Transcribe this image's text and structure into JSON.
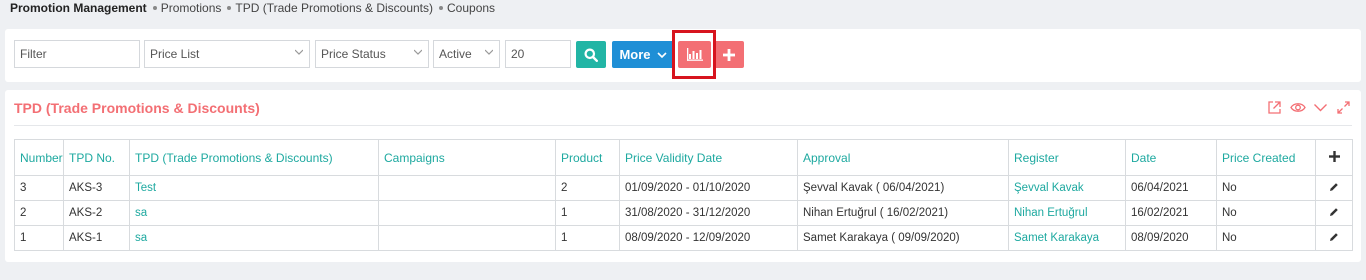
{
  "breadcrumb": {
    "root": "Promotion Management",
    "items": [
      "Promotions",
      "TPD (Trade Promotions & Discounts)",
      "Coupons"
    ]
  },
  "filters": {
    "filter_placeholder": "Filter",
    "price_list": "Price List",
    "price_status": "Price Status",
    "status": "Active",
    "page_size": "20"
  },
  "toolbar": {
    "more_label": "More"
  },
  "panel": {
    "title": "TPD (Trade Promotions & Discounts)"
  },
  "table": {
    "headers": [
      "Number",
      "TPD No.",
      "TPD (Trade Promotions & Discounts)",
      "Campaigns",
      "Product",
      "Price Validity Date",
      "Approval",
      "Register",
      "Date",
      "Price Created"
    ],
    "rows": [
      {
        "number": "3",
        "tpd_no": "AKS-3",
        "name": "Test",
        "campaigns": "",
        "product": "2",
        "validity": "01/09/2020 - 01/10/2020",
        "approval": "Şevval Kavak ( 06/04/2021)",
        "register": "Şevval Kavak",
        "date": "06/04/2021",
        "price_created": "No"
      },
      {
        "number": "2",
        "tpd_no": "AKS-2",
        "name": "sa",
        "campaigns": "",
        "product": "1",
        "validity": "31/08/2020 - 31/12/2020",
        "approval": "Nihan Ertuğrul ( 16/02/2021)",
        "register": "Nihan Ertuğrul",
        "date": "16/02/2021",
        "price_created": "No"
      },
      {
        "number": "1",
        "tpd_no": "AKS-1",
        "name": "sa",
        "campaigns": "",
        "product": "1",
        "validity": "08/09/2020 - 12/09/2020",
        "approval": "Samet Karakaya ( 09/09/2020)",
        "register": "Samet Karakaya",
        "date": "08/09/2020",
        "price_created": "No"
      }
    ]
  },
  "colors": {
    "accent_teal": "#1ea9a0",
    "more_blue": "#1f8fd6",
    "coral": "#f36f74",
    "highlight_red": "#d7141e"
  },
  "icons": [
    "search-icon",
    "chevron-down-icon",
    "bar-chart-icon",
    "plus-icon",
    "share-icon",
    "eye-icon",
    "collapse-icon",
    "expand-icon",
    "pencil-icon"
  ]
}
